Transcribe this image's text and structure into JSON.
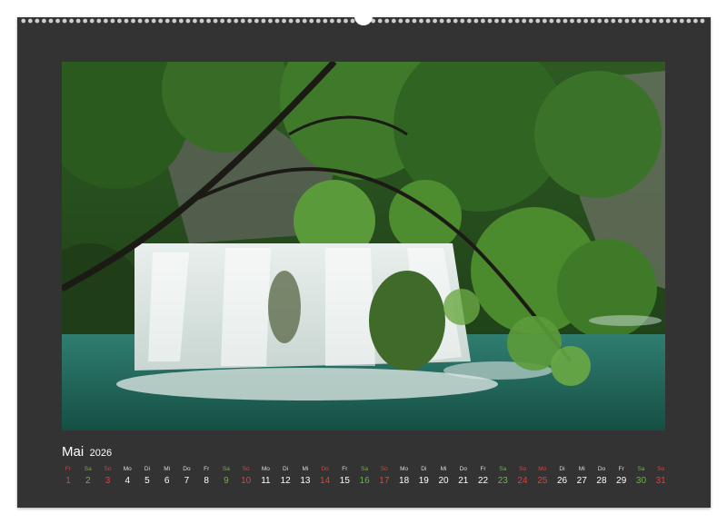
{
  "calendar": {
    "month": "Mai",
    "year": "2026",
    "days": [
      {
        "abbr": "Fr",
        "num": "1",
        "kind": "holiday"
      },
      {
        "abbr": "Sa",
        "num": "2",
        "kind": "sat"
      },
      {
        "abbr": "So",
        "num": "3",
        "kind": "sun"
      },
      {
        "abbr": "Mo",
        "num": "4",
        "kind": "weekday"
      },
      {
        "abbr": "Di",
        "num": "5",
        "kind": "weekday"
      },
      {
        "abbr": "Mi",
        "num": "6",
        "kind": "weekday"
      },
      {
        "abbr": "Do",
        "num": "7",
        "kind": "weekday"
      },
      {
        "abbr": "Fr",
        "num": "8",
        "kind": "weekday"
      },
      {
        "abbr": "Sa",
        "num": "9",
        "kind": "sat"
      },
      {
        "abbr": "So",
        "num": "10",
        "kind": "sun"
      },
      {
        "abbr": "Mo",
        "num": "11",
        "kind": "weekday"
      },
      {
        "abbr": "Di",
        "num": "12",
        "kind": "weekday"
      },
      {
        "abbr": "Mi",
        "num": "13",
        "kind": "weekday"
      },
      {
        "abbr": "Do",
        "num": "14",
        "kind": "holiday"
      },
      {
        "abbr": "Fr",
        "num": "15",
        "kind": "weekday"
      },
      {
        "abbr": "Sa",
        "num": "16",
        "kind": "sat"
      },
      {
        "abbr": "So",
        "num": "17",
        "kind": "sun"
      },
      {
        "abbr": "Mo",
        "num": "18",
        "kind": "weekday"
      },
      {
        "abbr": "Di",
        "num": "19",
        "kind": "weekday"
      },
      {
        "abbr": "Mi",
        "num": "20",
        "kind": "weekday"
      },
      {
        "abbr": "Do",
        "num": "21",
        "kind": "weekday"
      },
      {
        "abbr": "Fr",
        "num": "22",
        "kind": "weekday"
      },
      {
        "abbr": "Sa",
        "num": "23",
        "kind": "sat"
      },
      {
        "abbr": "So",
        "num": "24",
        "kind": "sun"
      },
      {
        "abbr": "Mo",
        "num": "25",
        "kind": "holiday"
      },
      {
        "abbr": "Di",
        "num": "26",
        "kind": "weekday"
      },
      {
        "abbr": "Mi",
        "num": "27",
        "kind": "weekday"
      },
      {
        "abbr": "Do",
        "num": "28",
        "kind": "weekday"
      },
      {
        "abbr": "Fr",
        "num": "29",
        "kind": "weekday"
      },
      {
        "abbr": "Sa",
        "num": "30",
        "kind": "sat"
      },
      {
        "abbr": "So",
        "num": "31",
        "kind": "sun"
      }
    ]
  },
  "colors": {
    "background": "#333333",
    "saturday": "#6fb24b",
    "sunday_holiday": "#e0403a",
    "weekday": "#ffffff"
  },
  "photo": {
    "subject": "waterfall-photo"
  }
}
